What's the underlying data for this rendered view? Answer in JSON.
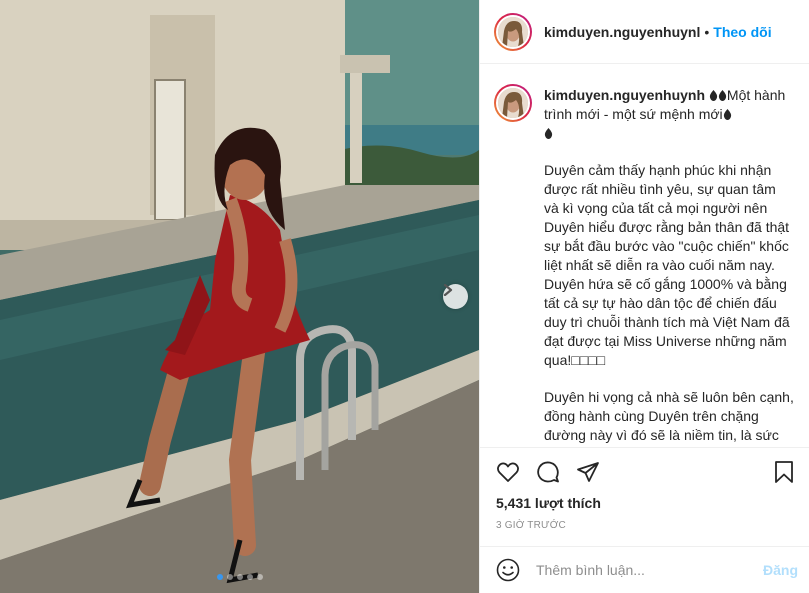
{
  "post": {
    "image_alt": "Photo of a woman in a red dress sitting by a swimming pool",
    "carousel": {
      "count": 5,
      "active_index": 0
    }
  },
  "header": {
    "username": "kimduyen.nguyenhuynl",
    "separator": "•",
    "follow_label": "Theo dõi"
  },
  "caption": {
    "username": "kimduyen.nguyenhuynh",
    "title_text": "Một hành trình mới - một sứ mệnh mới",
    "para1": "Duyên cảm thấy hạnh phúc khi nhận được rất nhiều tình yêu, sự quan tâm và kì vọng của tất cả mọi người nên Duyên hiểu được rằng bản thân đã thật sự bắt đầu bước vào \"cuộc chiến\" khốc liệt nhất sẽ diễn ra vào cuối năm nay. Duyên hứa sẽ cố gắng 1000% và bằng tất cả sự tự hào dân tộc để chiến đấu duy trì chuỗi thành tích mà Việt Nam đã đạt được tại Miss Universe những năm qua!",
    "para1_trailing": "□□□□",
    "para2": "Duyên hi vọng cả nhà sẽ luôn bên cạnh, đồng hành cùng Duyên trên chặng đường này vì đó sẽ là niềm tin, là sức mạnh để Duyên vượt qua mọi"
  },
  "actions": {
    "icons": [
      "heart-icon",
      "comment-icon",
      "share-icon",
      "bookmark-icon"
    ],
    "likes": "5,431 lượt thích",
    "time": "3 giờ trước"
  },
  "comment_box": {
    "placeholder": "Thêm bình luận...",
    "post_label": "Đăng"
  },
  "colors": {
    "accent": "#0095f6",
    "post_disabled": "#b2dffc",
    "carousel_dot": "#3897f0",
    "border": "#efefef",
    "muted": "#8e8e8e"
  }
}
